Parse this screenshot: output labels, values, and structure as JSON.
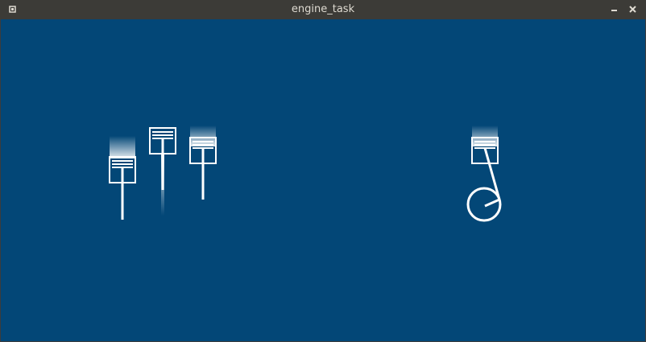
{
  "window": {
    "title": "engine_task"
  },
  "titlebar_icons": {
    "menu": "window-menu-icon",
    "minimize": "minimize-icon",
    "close": "close-icon"
  },
  "colors": {
    "titlebar_bg": "#3c3b37",
    "title_text": "#dfdbd2",
    "canvas_bg": "#034777",
    "line_white": "#ffffff"
  }
}
